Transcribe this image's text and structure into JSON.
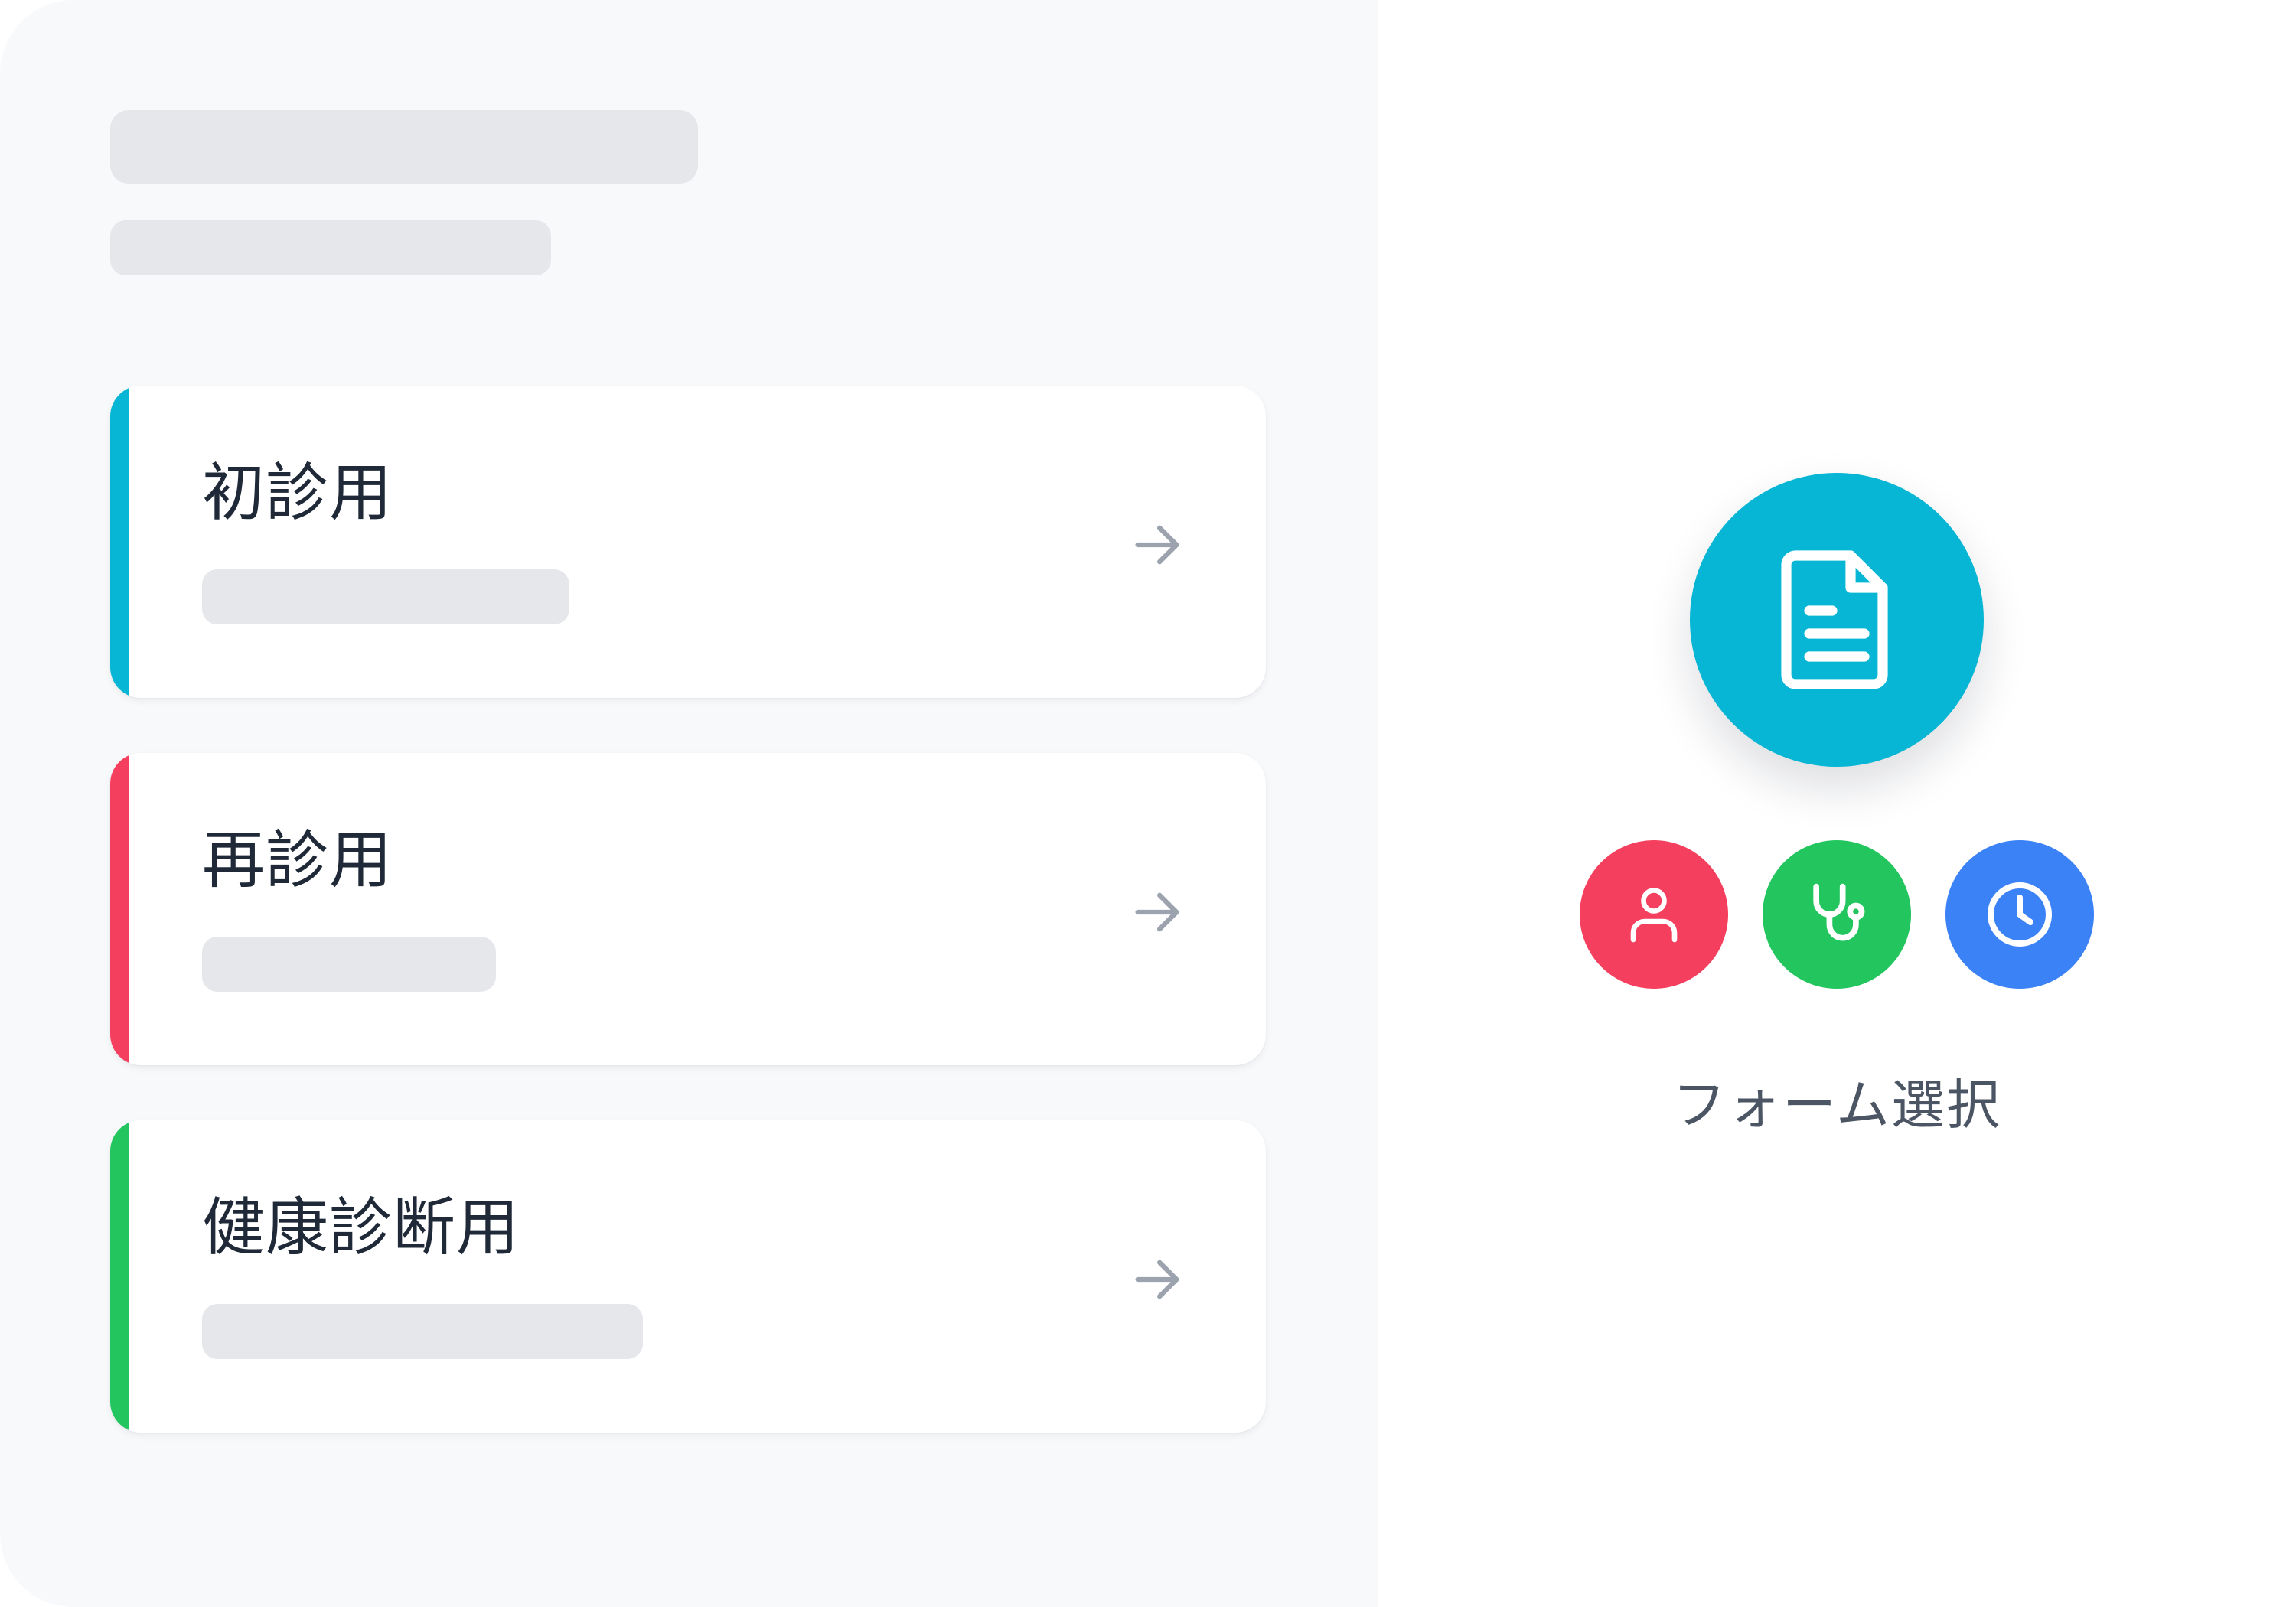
{
  "colors": {
    "panel_bg": "#f8f9fb",
    "skeleton": "#e5e7eb",
    "cyan": "#06b6d4",
    "red": "#f43f5e",
    "green": "#22c55e",
    "blue": "#3b82f6",
    "arrow": "#9ca3af"
  },
  "forms": [
    {
      "label": "初診用",
      "accent": "#06b6d4",
      "icon": "arrow-right-icon"
    },
    {
      "label": "再診用",
      "accent": "#f43f5e",
      "icon": "arrow-right-icon"
    },
    {
      "label": "健康診断用",
      "accent": "#22c55e",
      "icon": "arrow-right-icon"
    }
  ],
  "hero": {
    "main_icon": "document-icon",
    "sub_icons": [
      "user-icon",
      "stethoscope-icon",
      "clock-icon"
    ],
    "caption": "フォーム選択"
  }
}
